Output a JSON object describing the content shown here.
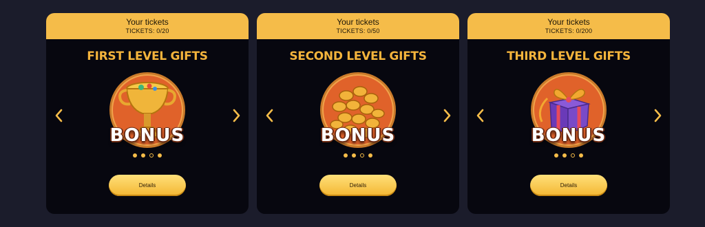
{
  "cards": [
    {
      "header_title": "Your tickets",
      "tickets": "TICKETS: 0/20",
      "title": "FIRST LEVEL GIFTS",
      "bonus_label": "BONUS",
      "details_label": "Details",
      "art_icon": "golden-cup-icon",
      "active_dot": 1
    },
    {
      "header_title": "Your tickets",
      "tickets": "TICKETS: 0/50",
      "title": "SECOND LEVEL GIFTS",
      "bonus_label": "BONUS",
      "details_label": "Details",
      "art_icon": "gold-coins-icon",
      "active_dot": 2
    },
    {
      "header_title": "Your tickets",
      "tickets": "TICKETS: 0/200",
      "title": "THIRD LEVEL GIFTS",
      "bonus_label": "BONUS",
      "details_label": "Details",
      "art_icon": "gift-box-icon",
      "active_dot": 3
    }
  ],
  "colors": {
    "page_bg": "#1b1c2b",
    "card_bg": "#07070f",
    "accent": "#f5bc49",
    "title": "#f4b43c",
    "medallion": "#e0622a"
  }
}
